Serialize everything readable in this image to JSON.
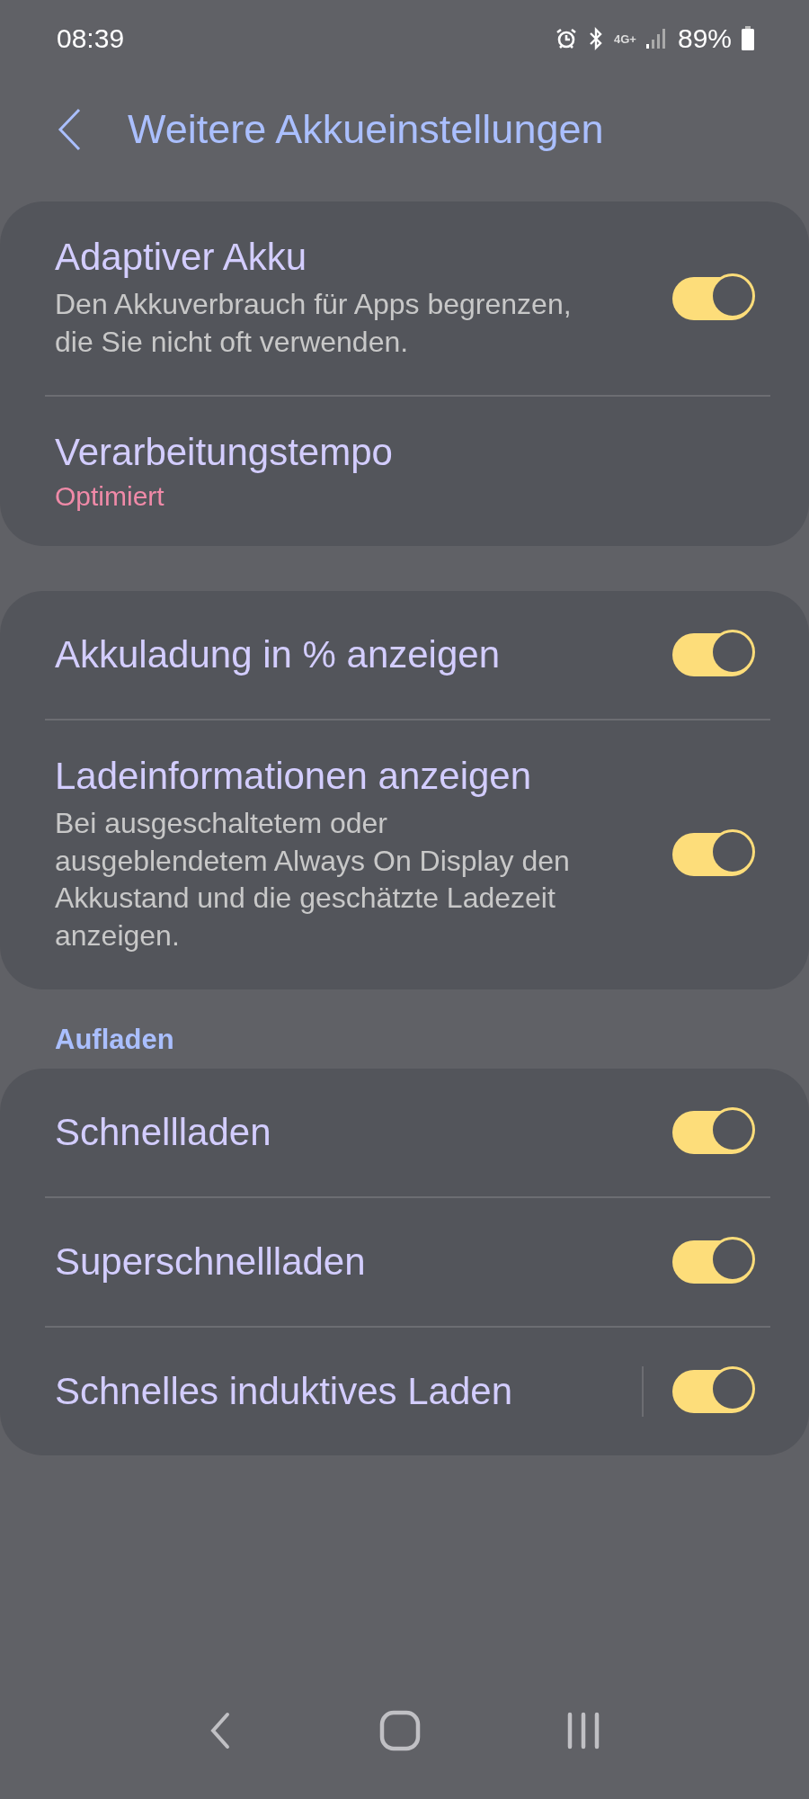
{
  "status_bar": {
    "time": "08:39",
    "network": "4G+",
    "battery": "89%"
  },
  "header": {
    "title": "Weitere Akkueinstellungen"
  },
  "groups": [
    {
      "items": [
        {
          "kind": "toggle",
          "title": "Adaptiver Akku",
          "subtitle": "Den Akkuverbrauch für Apps begrenzen, die Sie nicht oft verwenden.",
          "on": true,
          "split": false
        },
        {
          "kind": "value",
          "title": "Verarbeitungstempo",
          "value": "Optimiert"
        }
      ]
    },
    {
      "items": [
        {
          "kind": "toggle",
          "title": "Akkuladung in % anzeigen",
          "on": true,
          "split": false
        },
        {
          "kind": "toggle",
          "title": "Ladeinformationen anzeigen",
          "subtitle": "Bei ausgeschaltetem oder ausgeblendetem Always On Display den Akkustand und die geschätzte Ladezeit anzeigen.",
          "on": true,
          "split": false
        }
      ]
    },
    {
      "heading": "Aufladen",
      "items": [
        {
          "kind": "toggle",
          "title": "Schnellladen",
          "on": true,
          "split": false
        },
        {
          "kind": "toggle",
          "title": "Superschnellladen",
          "on": true,
          "split": false
        },
        {
          "kind": "toggle",
          "title": "Schnelles induktives Laden",
          "on": true,
          "split": true
        }
      ]
    }
  ]
}
